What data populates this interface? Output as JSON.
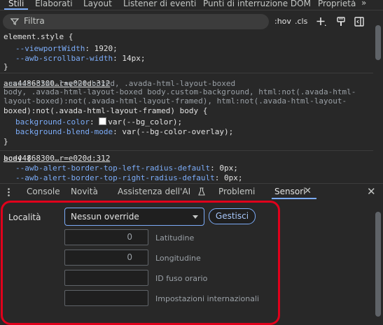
{
  "top_tabs": [
    "Stili",
    "Elaborati",
    "Layout",
    "Listener di eventi",
    "Punti di interruzione DOM",
    "Proprietà"
  ],
  "top_more": "»",
  "filter": {
    "placeholder": "Filtra",
    "hov": ":hov",
    "cls": ".cls"
  },
  "rules": {
    "element_style": {
      "selector": "element.style {",
      "decls": [
        {
          "prop": "--viewportWidth",
          "value": "1920;"
        },
        {
          "prop": "--awb-scrollbar-width",
          "value": "14px;"
        }
      ],
      "close": "}"
    },
    "avada": {
      "source": "aca44868300…r=e020d:312",
      "selector_lines": [
        ".avada-html-layout-boxed, .avada-html-layout-boxed",
        "body, .avada-html-layout-boxed body.custom-background, html:not(.avada-html-",
        "layout-boxed):not(.avada-html-layout-framed), html:not(.avada-html-layout-",
        "boxed):not(.avada-html-layout-framed) body {"
      ],
      "decls": [
        {
          "prop": "background-color",
          "value": "var(--bg_color);"
        },
        {
          "prop": "background-blend-mode",
          "value": "var(--bg-color-overlay);"
        }
      ],
      "close": "}"
    },
    "body": {
      "source": "aca44868300…r=e020d:312",
      "selector": "body {",
      "decls": [
        {
          "prop": "--awb-alert-border-top-left-radius-default",
          "value": "0px;"
        },
        {
          "prop": "--awb-alert-border-top-right-radius-default",
          "value": "0px;"
        }
      ]
    }
  },
  "drawer_tabs": [
    "Console",
    "Novità",
    "Assistenza dell'AI",
    "Problemi",
    "Sensori"
  ],
  "drawer_close": "✕",
  "sensors": {
    "location_label": "Località",
    "location_value": "Nessun override",
    "manage_button": "Gestisci",
    "fields": [
      {
        "value": "0",
        "label": "Latitudine"
      },
      {
        "value": "0",
        "label": "Longitudine"
      },
      {
        "value": "",
        "label": "ID fuso orario"
      },
      {
        "value": "",
        "label": "Impostazioni internazionali"
      }
    ]
  },
  "colors": {
    "highlight": "#e0001b",
    "accent": "#7cacf8",
    "background": "#282828"
  }
}
